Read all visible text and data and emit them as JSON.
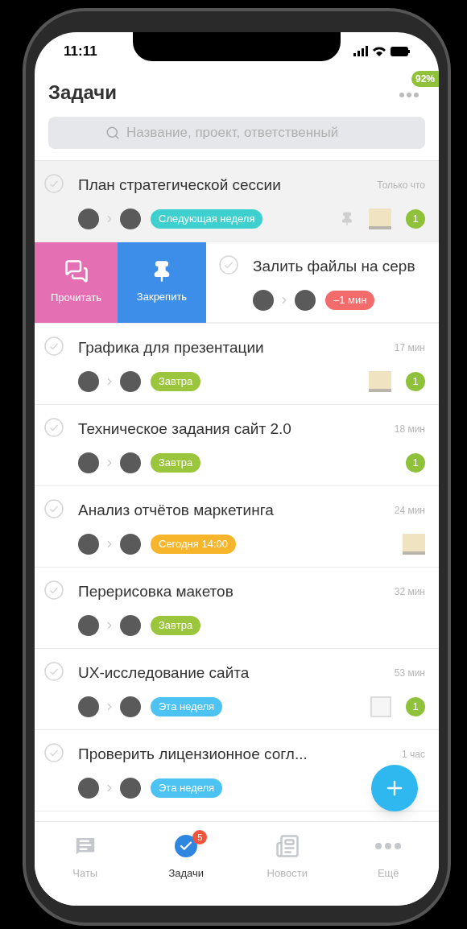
{
  "status_bar": {
    "time": "11:11"
  },
  "header": {
    "title": "Задачи",
    "badge": "92%"
  },
  "search": {
    "placeholder": "Название, проект, ответственный"
  },
  "tasks": [
    {
      "title": "План стратегической сессии",
      "time": "Только что",
      "tag": {
        "text": "Следующая неделя",
        "color": "#3ecfcf"
      },
      "pinned": true,
      "attachment": {
        "kind": "image"
      },
      "comments": "1",
      "swiped": false
    },
    {
      "title": "Залить файлы на серв",
      "tag": {
        "text": "–1 мин",
        "color": "#f36b6b"
      },
      "pinned": false,
      "swiped": true,
      "actions": [
        {
          "label": "Прочитать",
          "kind": "read",
          "color": "#e46fb3"
        },
        {
          "label": "Закрепить",
          "kind": "pin",
          "color": "#3d8ee8"
        }
      ]
    },
    {
      "title": "Графика для презентации",
      "time": "17 мин",
      "tag": {
        "text": "Завтра",
        "color": "#9bc53d"
      },
      "pinned": false,
      "attachment": {
        "kind": "image"
      },
      "comments": "1",
      "swiped": false
    },
    {
      "title": "Техническое задания сайт 2.0",
      "time": "18 мин",
      "tag": {
        "text": "Завтра",
        "color": "#9bc53d"
      },
      "pinned": false,
      "comments": "1",
      "swiped": false
    },
    {
      "title": "Анализ отчётов маркетинга",
      "time": "24 мин",
      "tag": {
        "text": "Сегодня 14:00",
        "color": "#f7b52c"
      },
      "pinned": false,
      "attachment": {
        "kind": "image"
      },
      "swiped": false
    },
    {
      "title": "Перерисовка макетов",
      "time": "32 мин",
      "tag": {
        "text": "Завтра",
        "color": "#9bc53d"
      },
      "pinned": false,
      "swiped": false
    },
    {
      "title": "UX-исследование сайта",
      "time": "53 мин",
      "tag": {
        "text": "Эта неделя",
        "color": "#4cc3f3"
      },
      "pinned": false,
      "attachment": {
        "kind": "file"
      },
      "comments": "1",
      "swiped": false
    },
    {
      "title": "Проверить лицензионное согл...",
      "time": "1 час",
      "tag": {
        "text": "Эта неделя",
        "color": "#4cc3f3"
      },
      "pinned": false,
      "swiped": false
    }
  ],
  "tabs": [
    {
      "label": "Чаты",
      "kind": "chats",
      "selected": false
    },
    {
      "label": "Задачи",
      "kind": "tasks",
      "selected": true,
      "badge": "5"
    },
    {
      "label": "Новости",
      "kind": "news",
      "selected": false
    },
    {
      "label": "Ещё",
      "kind": "more",
      "selected": false
    }
  ]
}
